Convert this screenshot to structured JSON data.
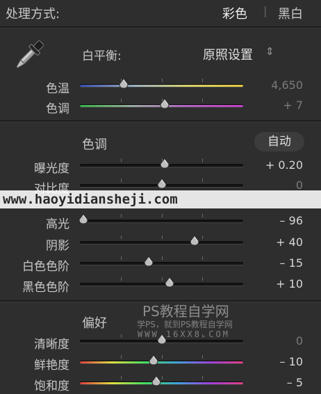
{
  "treatment": {
    "label": "处理方式:",
    "color": "彩色",
    "divider": "|",
    "bw": "黑白"
  },
  "wb": {
    "label": "白平衡:",
    "preset": "原照设置",
    "preset_arrow": "⇕",
    "temp": {
      "label": "色温",
      "value": "4,650",
      "level": 0.27
    },
    "tint": {
      "label": "色调",
      "value": "+ 7",
      "level": 0.52
    }
  },
  "tone": {
    "title": "色调",
    "auto": "自动",
    "exposure": {
      "label": "曝光度",
      "value": "+ 0.20",
      "level": 0.52
    },
    "contrast": {
      "label": "对比度",
      "value": "0",
      "level": 0.5
    },
    "highlights": {
      "label": "高光",
      "value": "– 96",
      "level": 0.02
    },
    "shadows": {
      "label": "阴影",
      "value": "+ 40",
      "level": 0.7
    },
    "whites": {
      "label": "白色色阶",
      "value": "– 15",
      "level": 0.42
    },
    "blacks": {
      "label": "黑色色阶",
      "value": "+ 10",
      "level": 0.55
    }
  },
  "presence": {
    "title": "偏好",
    "clarity": {
      "label": "清晰度",
      "value": "0",
      "level": 0.5
    },
    "vibrance": {
      "label": "鲜艳度",
      "value": "– 10",
      "level": 0.45
    },
    "saturation": {
      "label": "饱和度",
      "value": "– 5",
      "level": 0.47
    }
  },
  "watermarks": {
    "site1": "www.haoyidiansheji.com",
    "site2_title": "PS教程自学网",
    "site2_sub": "学PS，就到PS教程自学网",
    "site2_url": "WWW.16XX8.COM"
  },
  "colors": {
    "temp_gradient": [
      "#3a4fb0",
      "#9ab0c0",
      "#d8d06a",
      "#e0c640"
    ],
    "tint_gradient": [
      "#3ab04a",
      "#9aa6a0",
      "#b060c0",
      "#c040c0"
    ],
    "sat_gradient": [
      "#e04040",
      "#e0e040",
      "#40e060",
      "#40a0e0",
      "#a040e0",
      "#e04080"
    ]
  }
}
